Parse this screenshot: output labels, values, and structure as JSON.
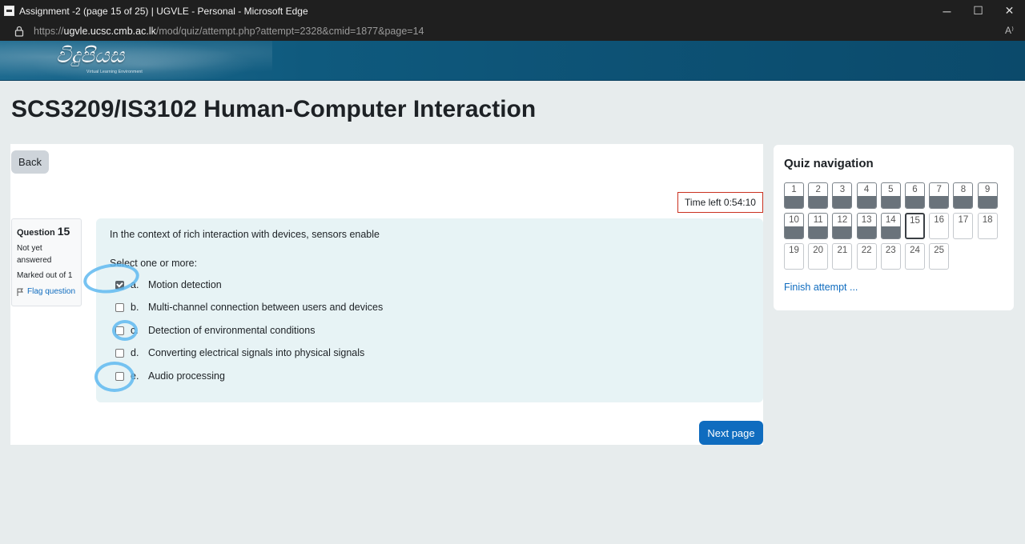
{
  "window": {
    "title": "Assignment -2 (page 15 of 25) | UGVLE - Personal - Microsoft Edge",
    "minimize": "─",
    "maximize": "☐",
    "close": "✕"
  },
  "address": {
    "prefix": "https://",
    "host": "ugvle.ucsc.cmb.ac.lk",
    "path": "/mod/quiz/attempt.php?attempt=2328&cmid=1877&page=14",
    "read_aloud": "A⁾"
  },
  "banner": {
    "logo_text": "විදුපියස",
    "logo_sub": "Virtual Learning Environment"
  },
  "course_title": "SCS3209/IS3102 Human-Computer Interaction",
  "back_label": "Back",
  "timer": "Time left 0:54:10",
  "question": {
    "label": "Question",
    "number": "15",
    "state": "Not yet answered",
    "grade": "Marked out of 1",
    "flag_label": "Flag question",
    "text": "In the context of rich interaction with devices, sensors enable",
    "prompt": "Select one or more:",
    "options": [
      {
        "letter": "a.",
        "text": "Motion detection",
        "checked": true
      },
      {
        "letter": "b.",
        "text": "Multi-channel connection between users and devices",
        "checked": false
      },
      {
        "letter": "c.",
        "text": "Detection of environmental conditions",
        "checked": false
      },
      {
        "letter": "d.",
        "text": "Converting electrical signals into physical signals",
        "checked": false
      },
      {
        "letter": "e.",
        "text": "Audio processing",
        "checked": false
      }
    ]
  },
  "next_label": "Next page",
  "quiz_nav": {
    "title": "Quiz navigation",
    "buttons": [
      "1",
      "2",
      "3",
      "4",
      "5",
      "6",
      "7",
      "8",
      "9",
      "10",
      "11",
      "12",
      "13",
      "14",
      "15",
      "16",
      "17",
      "18",
      "19",
      "20",
      "21",
      "22",
      "23",
      "24",
      "25"
    ],
    "answered": [
      1,
      2,
      3,
      4,
      5,
      6,
      7,
      8,
      9,
      10,
      11,
      12,
      13,
      14
    ],
    "current": 15,
    "finish_label": "Finish attempt ..."
  },
  "colors": {
    "primary": "#0f6cbf",
    "timer_border": "#ca3120",
    "annotation": "#5fb9f0"
  }
}
